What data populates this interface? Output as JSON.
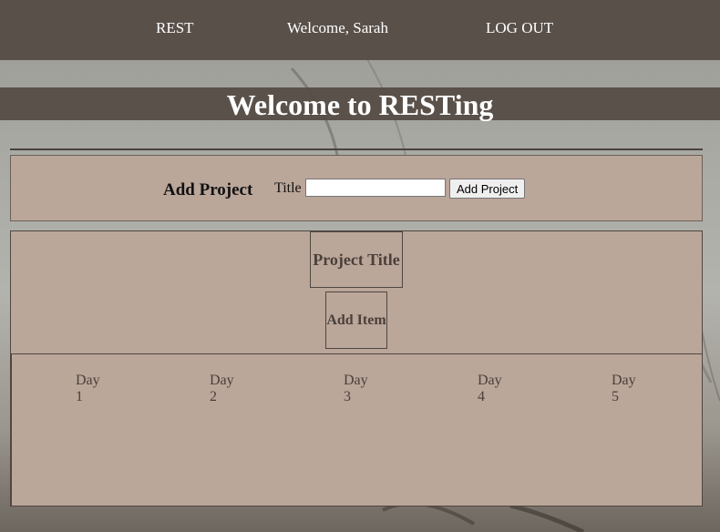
{
  "navbar": {
    "brand": "REST",
    "welcome": "Welcome, Sarah",
    "logout": "LOG OUT"
  },
  "page_title": "Welcome to RESTing",
  "add_project": {
    "heading": "Add Project",
    "title_label": "Title",
    "title_value": "",
    "button_label": "Add Project"
  },
  "project": {
    "title": "Project Title",
    "add_item_label": "Add Item",
    "days": [
      {
        "word": "Day",
        "number": "1"
      },
      {
        "word": "Day",
        "number": "2"
      },
      {
        "word": "Day",
        "number": "3"
      },
      {
        "word": "Day",
        "number": "4"
      },
      {
        "word": "Day",
        "number": "5"
      }
    ]
  },
  "colors": {
    "bar": "#544a44",
    "panel": "#bba69a",
    "border": "#4f4740"
  }
}
